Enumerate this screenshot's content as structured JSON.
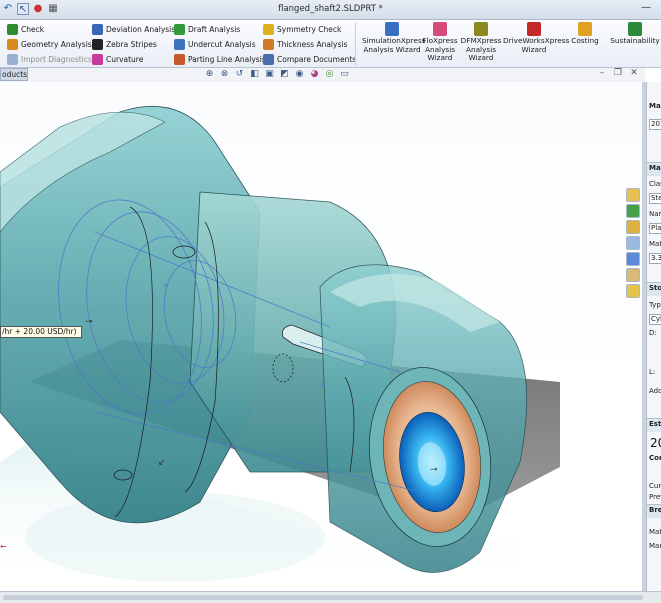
{
  "window": {
    "title": "flanged_shaft2.SLDPRT *"
  },
  "ribbon": {
    "col1": [
      {
        "label": "Check",
        "icon": "check-icon",
        "color": "#2e8b2e"
      },
      {
        "label": "Geometry Analysis",
        "icon": "geometry-analysis-icon",
        "color": "#d88a1c"
      },
      {
        "label": "Import Diagnostics",
        "icon": "import-diagnostics-icon",
        "color": "#9ab0d0",
        "disabled": true
      }
    ],
    "col2": [
      {
        "label": "Deviation Analysis",
        "icon": "deviation-analysis-icon",
        "color": "#3a66b8"
      },
      {
        "label": "Zebra Stripes",
        "icon": "zebra-stripes-icon",
        "color": "#222222"
      },
      {
        "label": "Curvature",
        "icon": "curvature-icon",
        "color": "#c9389b"
      }
    ],
    "col3": [
      {
        "label": "Draft Analysis",
        "icon": "draft-analysis-icon",
        "color": "#2f9a3e"
      },
      {
        "label": "Undercut Analysis",
        "icon": "undercut-analysis-icon",
        "color": "#3d72c0"
      },
      {
        "label": "Parting Line Analysis",
        "icon": "parting-line-analysis-icon",
        "color": "#c45a2a"
      }
    ],
    "col4": [
      {
        "label": "Symmetry Check",
        "icon": "symmetry-check-icon",
        "color": "#e0b020"
      },
      {
        "label": "Thickness Analysis",
        "icon": "thickness-analysis-icon",
        "color": "#d07a28"
      },
      {
        "label": "Compare Documents",
        "icon": "compare-documents-icon",
        "color": "#4a6ea8"
      }
    ],
    "big": [
      {
        "label": "SimulationXpress Analysis Wizard",
        "icon": "simulationxpress-icon",
        "color": "#3a6ec2"
      },
      {
        "label": "FloXpress Analysis Wizard",
        "icon": "floxpress-icon",
        "color": "#d84a7a"
      },
      {
        "label": "DFMXpress Analysis Wizard",
        "icon": "dfmxpress-icon",
        "color": "#8a8a20"
      },
      {
        "label": "DriveWorksXpress Wizard",
        "icon": "driveworksxpress-icon",
        "color": "#c22a2a"
      },
      {
        "label": "Costing",
        "icon": "costing-icon",
        "color": "#e0a020"
      },
      {
        "label": "Sustainability",
        "icon": "sustainability-icon",
        "color": "#2a8a3a"
      }
    ]
  },
  "tabs": {
    "products": "oducts"
  },
  "viewport": {
    "tooltip": "/hr + 20.00 USD/hr)",
    "side_mark": "←"
  },
  "panel": {
    "labels": [
      {
        "text": "Ma",
        "bold": true
      },
      {
        "text": "201",
        "box": true
      },
      {
        "text": "Ma",
        "bold": true,
        "head": true
      },
      {
        "text": "Clas"
      },
      {
        "text": "Ste",
        "box": true
      },
      {
        "text": "Nam"
      },
      {
        "text": "Pla",
        "box": true
      },
      {
        "text": "Mat"
      },
      {
        "text": "3.3",
        "box": true
      },
      {
        "text": "Sto",
        "bold": true,
        "head": true
      },
      {
        "text": "Typ"
      },
      {
        "text": "Cyl",
        "box": true
      },
      {
        "text": "D:"
      },
      {
        "text": "L:"
      },
      {
        "text": "Add"
      },
      {
        "text": "Est",
        "bold": true,
        "head": true
      },
      {
        "text": "20",
        "big": true
      },
      {
        "text": "Com",
        "bold": true
      },
      {
        "text": "Cur"
      },
      {
        "text": "Prev"
      },
      {
        "text": "Brea",
        "bold": true,
        "head": true
      },
      {
        "text": "Mat"
      },
      {
        "text": "Man"
      }
    ]
  }
}
